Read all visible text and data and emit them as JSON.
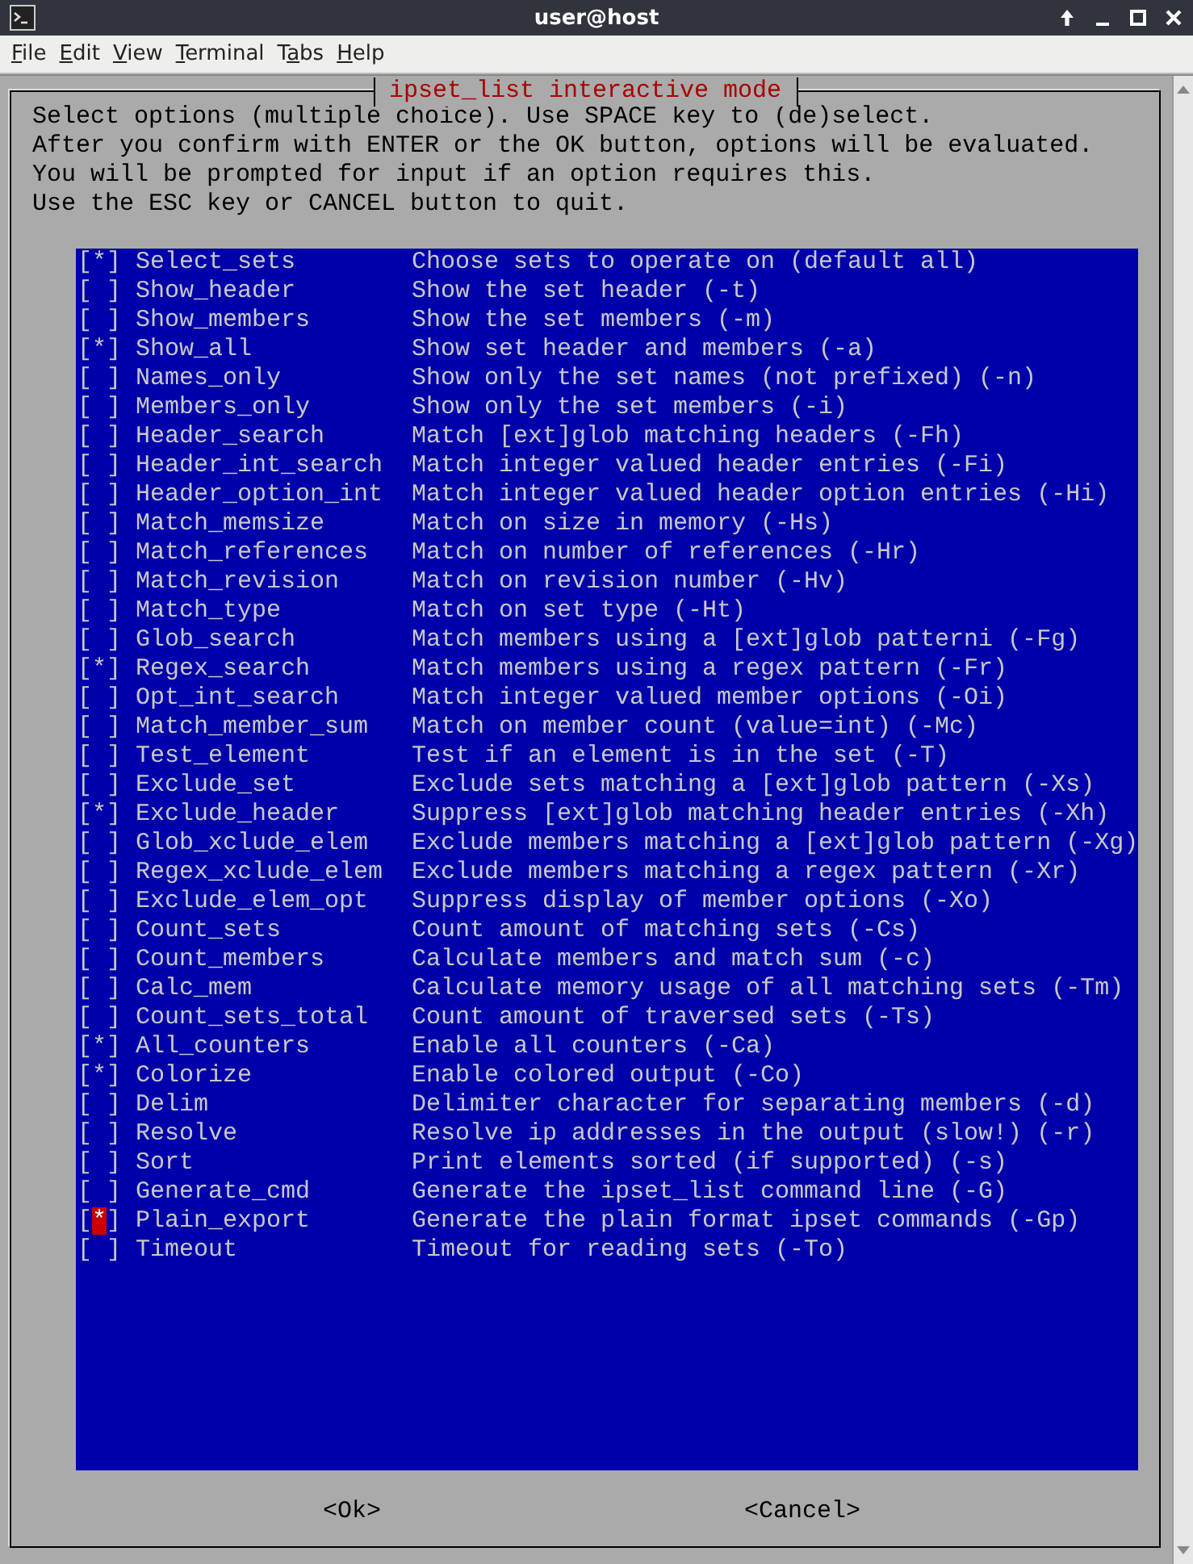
{
  "window": {
    "title": "user@host"
  },
  "menu": [
    {
      "key": "F",
      "post": "ile"
    },
    {
      "key": "E",
      "post": "dit"
    },
    {
      "key": "V",
      "post": "iew"
    },
    {
      "key": "T",
      "post": "erminal"
    },
    {
      "pre": "T",
      "key": "a",
      "post": "bs"
    },
    {
      "key": "H",
      "post": "elp"
    }
  ],
  "dialog": {
    "title": "ipset_list interactive mode",
    "instructions": [
      "Select options (multiple choice). Use SPACE key to (de)select.",
      "After you confirm with ENTER or the OK button, options will be evaluated.",
      "You will be prompted for input if an option requires this.",
      "Use the ESC key or CANCEL button to quit."
    ],
    "options": [
      {
        "open": "[",
        "check": "*",
        "close": "]",
        "checked": true,
        "cursor": false,
        "name": "Select_sets",
        "description": "Choose sets to operate on (default all)"
      },
      {
        "open": "[",
        "close": "]",
        "checked": false,
        "cursor": false,
        "name": "Show_header",
        "description": "Show the set header (-t)"
      },
      {
        "open": "[",
        "close": "]",
        "checked": false,
        "cursor": false,
        "name": "Show_members",
        "description": "Show the set members (-m)"
      },
      {
        "open": "[",
        "check": "*",
        "close": "]",
        "checked": true,
        "cursor": false,
        "name": "Show_all",
        "description": "Show set header and members (-a)"
      },
      {
        "open": "[",
        "close": "]",
        "checked": false,
        "cursor": false,
        "name": "Names_only",
        "description": "Show only the set names (not prefixed) (-n)"
      },
      {
        "open": "[",
        "close": "]",
        "checked": false,
        "cursor": false,
        "name": "Members_only",
        "description": "Show only the set members (-i)"
      },
      {
        "open": "[",
        "close": "]",
        "checked": false,
        "cursor": false,
        "name": "Header_search",
        "description": "Match [ext]glob matching headers (-Fh)"
      },
      {
        "open": "[",
        "close": "]",
        "checked": false,
        "cursor": false,
        "name": "Header_int_search",
        "description": "Match integer valued header entries (-Fi)"
      },
      {
        "open": "[",
        "close": "]",
        "checked": false,
        "cursor": false,
        "name": "Header_option_int",
        "description": "Match integer valued header option entries (-Hi)"
      },
      {
        "open": "[",
        "close": "]",
        "checked": false,
        "cursor": false,
        "name": "Match_memsize",
        "description": "Match on size in memory (-Hs)"
      },
      {
        "open": "[",
        "close": "]",
        "checked": false,
        "cursor": false,
        "name": "Match_references",
        "description": "Match on number of references (-Hr)"
      },
      {
        "open": "[",
        "close": "]",
        "checked": false,
        "cursor": false,
        "name": "Match_revision",
        "description": "Match on revision number (-Hv)"
      },
      {
        "open": "[",
        "close": "]",
        "checked": false,
        "cursor": false,
        "name": "Match_type",
        "description": "Match on set type (-Ht)"
      },
      {
        "open": "[",
        "close": "]",
        "checked": false,
        "cursor": false,
        "name": "Glob_search",
        "description": "Match members using a [ext]glob patterni (-Fg)"
      },
      {
        "open": "[",
        "check": "*",
        "close": "]",
        "checked": true,
        "cursor": false,
        "name": "Regex_search",
        "description": "Match members using a regex pattern (-Fr)"
      },
      {
        "open": "[",
        "close": "]",
        "checked": false,
        "cursor": false,
        "name": "Opt_int_search",
        "description": "Match integer valued member options (-Oi)"
      },
      {
        "open": "[",
        "close": "]",
        "checked": false,
        "cursor": false,
        "name": "Match_member_sum",
        "description": "Match on member count (value=int) (-Mc)"
      },
      {
        "open": "[",
        "close": "]",
        "checked": false,
        "cursor": false,
        "name": "Test_element",
        "description": "Test if an element is in the set (-T)"
      },
      {
        "open": "[",
        "close": "]",
        "checked": false,
        "cursor": false,
        "name": "Exclude_set",
        "description": "Exclude sets matching a [ext]glob pattern (-Xs)"
      },
      {
        "open": "[",
        "check": "*",
        "close": "]",
        "checked": true,
        "cursor": false,
        "name": "Exclude_header",
        "description": "Suppress [ext]glob matching header entries (-Xh)"
      },
      {
        "open": "[",
        "close": "]",
        "checked": false,
        "cursor": false,
        "name": "Glob_xclude_elem",
        "description": "Exclude members matching a [ext]glob pattern (-Xg)"
      },
      {
        "open": "[",
        "close": "]",
        "checked": false,
        "cursor": false,
        "name": "Regex_xclude_elem",
        "description": "Exclude members matching a regex pattern (-Xr)"
      },
      {
        "open": "[",
        "close": "]",
        "checked": false,
        "cursor": false,
        "name": "Exclude_elem_opt",
        "description": "Suppress display of member options (-Xo)"
      },
      {
        "open": "[",
        "close": "]",
        "checked": false,
        "cursor": false,
        "name": "Count_sets",
        "description": "Count amount of matching sets (-Cs)"
      },
      {
        "open": "[",
        "close": "]",
        "checked": false,
        "cursor": false,
        "name": "Count_members",
        "description": "Calculate members and match sum (-c)"
      },
      {
        "open": "[",
        "close": "]",
        "checked": false,
        "cursor": false,
        "name": "Calc_mem",
        "description": "Calculate memory usage of all matching sets (-Tm)"
      },
      {
        "open": "[",
        "close": "]",
        "checked": false,
        "cursor": false,
        "name": "Count_sets_total",
        "description": "Count amount of traversed sets (-Ts)"
      },
      {
        "open": "[",
        "check": "*",
        "close": "]",
        "checked": true,
        "cursor": false,
        "name": "All_counters",
        "description": "Enable all counters (-Ca)"
      },
      {
        "open": "[",
        "check": "*",
        "close": "]",
        "checked": true,
        "cursor": false,
        "name": "Colorize",
        "description": "Enable colored output (-Co)"
      },
      {
        "open": "[",
        "close": "]",
        "checked": false,
        "cursor": false,
        "name": "Delim",
        "description": "Delimiter character for separating members (-d)"
      },
      {
        "open": "[",
        "close": "]",
        "checked": false,
        "cursor": false,
        "name": "Resolve",
        "description": "Resolve ip addresses in the output (slow!) (-r)"
      },
      {
        "open": "[",
        "close": "]",
        "checked": false,
        "cursor": false,
        "name": "Sort",
        "description": "Print elements sorted (if supported) (-s)"
      },
      {
        "open": "[",
        "close": "]",
        "checked": false,
        "cursor": false,
        "name": "Generate_cmd",
        "description": "Generate the ipset_list command line (-G)"
      },
      {
        "open": "[",
        "check": "*",
        "close": "]",
        "checked": true,
        "cursor": true,
        "name": "Plain_export",
        "description": "Generate the plain format ipset commands (-Gp)"
      },
      {
        "open": "[",
        "close": "]",
        "checked": false,
        "cursor": false,
        "name": "Timeout",
        "description": "Timeout for reading sets (-To)"
      }
    ],
    "buttons": [
      "<Ok>",
      "<Cancel>"
    ]
  }
}
